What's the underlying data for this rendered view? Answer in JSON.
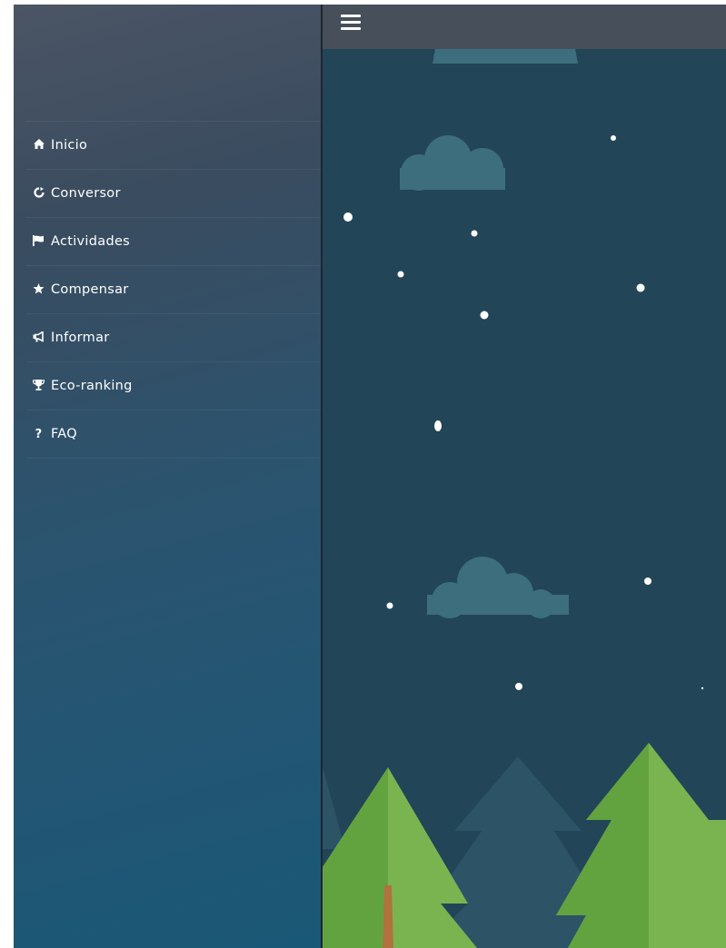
{
  "sidebar": {
    "items": [
      {
        "label": "Inicio",
        "icon": "home-icon",
        "glyph": "🏠"
      },
      {
        "label": "Conversor",
        "icon": "refresh-icon",
        "glyph": "⟳"
      },
      {
        "label": "Actividades",
        "icon": "flag-icon",
        "glyph": "⚑"
      },
      {
        "label": "Compensar",
        "icon": "star-icon",
        "glyph": "★"
      },
      {
        "label": "Informar",
        "icon": "megaphone-icon",
        "glyph": "📢"
      },
      {
        "label": "Eco-ranking",
        "icon": "trophy-icon",
        "glyph": "🏆"
      },
      {
        "label": "FAQ",
        "icon": "question-icon",
        "glyph": "?"
      }
    ]
  },
  "header": {
    "menu_icon": "hamburger-menu-icon"
  },
  "colors": {
    "sky": "#234558",
    "topbar": "#474f5a",
    "cloud": "#3c6e7e",
    "tree_light": "#7ab450",
    "tree_dark": "#63a33f",
    "tree_shadow": "#2c5366",
    "snow": "#ffffff"
  }
}
